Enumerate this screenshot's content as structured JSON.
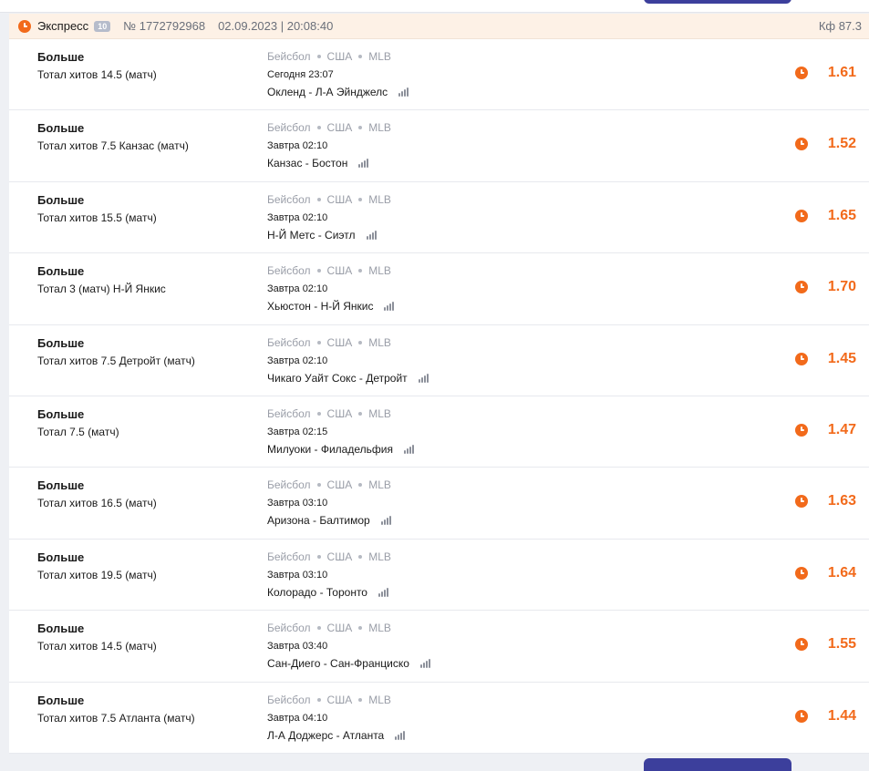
{
  "header": {
    "title": "Экспресс",
    "badge": "10",
    "number": "№ 1772792968",
    "datetime": "02.09.2023 | 20:08:40",
    "coef": "Кф 87.3"
  },
  "colors": {
    "accent": "#f26a1b",
    "button": "#3c3f9c"
  },
  "icons": {
    "status": "clock-icon",
    "stats": "stats-icon"
  },
  "rows": [
    {
      "title": "Больше",
      "market": "Тотал хитов 14.5 (матч)",
      "sport": "Бейсбол",
      "country": "США",
      "league": "MLB",
      "time": "Сегодня 23:07",
      "teams": "Окленд - Л-А Эйнджелс",
      "odds": "1.61"
    },
    {
      "title": "Больше",
      "market": "Тотал хитов 7.5 Канзас (матч)",
      "sport": "Бейсбол",
      "country": "США",
      "league": "MLB",
      "time": "Завтра 02:10",
      "teams": "Канзас - Бостон",
      "odds": "1.52"
    },
    {
      "title": "Больше",
      "market": "Тотал хитов 15.5 (матч)",
      "sport": "Бейсбол",
      "country": "США",
      "league": "MLB",
      "time": "Завтра 02:10",
      "teams": "Н-Й Метс - Сиэтл",
      "odds": "1.65"
    },
    {
      "title": "Больше",
      "market": "Тотал 3 (матч) Н-Й Янкис",
      "sport": "Бейсбол",
      "country": "США",
      "league": "MLB",
      "time": "Завтра 02:10",
      "teams": "Хьюстон - Н-Й Янкис",
      "odds": "1.70"
    },
    {
      "title": "Больше",
      "market": "Тотал хитов 7.5 Детройт (матч)",
      "sport": "Бейсбол",
      "country": "США",
      "league": "MLB",
      "time": "Завтра 02:10",
      "teams": "Чикаго Уайт Сокс - Детройт",
      "odds": "1.45"
    },
    {
      "title": "Больше",
      "market": "Тотал 7.5 (матч)",
      "sport": "Бейсбол",
      "country": "США",
      "league": "MLB",
      "time": "Завтра 02:15",
      "teams": "Милуоки - Филадельфия",
      "odds": "1.47"
    },
    {
      "title": "Больше",
      "market": "Тотал хитов 16.5 (матч)",
      "sport": "Бейсбол",
      "country": "США",
      "league": "MLB",
      "time": "Завтра 03:10",
      "teams": "Аризона - Балтимор",
      "odds": "1.63"
    },
    {
      "title": "Больше",
      "market": "Тотал хитов 19.5 (матч)",
      "sport": "Бейсбол",
      "country": "США",
      "league": "MLB",
      "time": "Завтра 03:10",
      "teams": "Колорадо - Торонто",
      "odds": "1.64"
    },
    {
      "title": "Больше",
      "market": "Тотал хитов 14.5 (матч)",
      "sport": "Бейсбол",
      "country": "США",
      "league": "MLB",
      "time": "Завтра 03:40",
      "teams": "Сан-Диего - Сан-Франциско",
      "odds": "1.55"
    },
    {
      "title": "Больше",
      "market": "Тотал хитов 7.5 Атланта (матч)",
      "sport": "Бейсбол",
      "country": "США",
      "league": "MLB",
      "time": "Завтра 04:10",
      "teams": "Л-А Доджерс - Атланта",
      "odds": "1.44"
    }
  ]
}
